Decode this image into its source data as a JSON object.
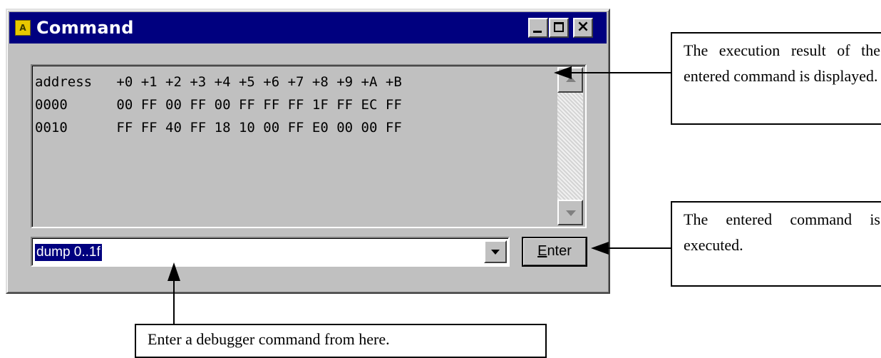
{
  "window": {
    "title": "Command",
    "app_icon": "ab-app-icon",
    "controls": [
      "minimize-icon",
      "maximize-icon",
      "close-icon"
    ]
  },
  "output": {
    "lines": [
      "address   +0 +1 +2 +3 +4 +5 +6 +7 +8 +9 +A +B",
      "0000      00 FF 00 FF 00 FF FF FF 1F FF EC FF",
      "0010      FF FF 40 FF 18 10 00 FF E0 00 00 FF"
    ]
  },
  "command": {
    "value": "dump 0..1f",
    "enter_label_underlined": "E",
    "enter_label_rest": "nter"
  },
  "callouts": {
    "result": "The execution result of the entered command is displayed.",
    "execute": "The entered command is executed.",
    "enter": "Enter a debugger command from here."
  }
}
